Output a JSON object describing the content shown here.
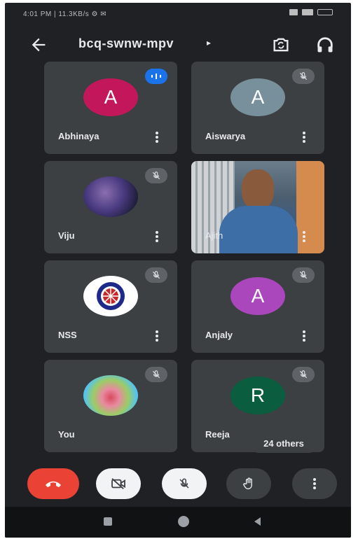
{
  "status_bar": {
    "left_text": "4:01 PM | 11.3KB/s ⚙ ✉",
    "right_text": ""
  },
  "header": {
    "meeting_code": "bcq-swnw-mpv",
    "caret": "▸",
    "icons": [
      "back-arrow-icon",
      "switch-camera-icon",
      "headphones-icon"
    ]
  },
  "participants": [
    {
      "name": "Abhinaya",
      "avatar_letter": "A",
      "avatar_color": "#c2185b",
      "status": "speaking"
    },
    {
      "name": "Aiswarya",
      "avatar_letter": "A",
      "avatar_color": "#78909c",
      "status": "muted"
    },
    {
      "name": "Viju",
      "avatar_letter": "",
      "avatar_type": "photo",
      "status": "muted"
    },
    {
      "name": "Ajith",
      "avatar_letter": "",
      "avatar_type": "video",
      "status": "video"
    },
    {
      "name": "NSS",
      "avatar_letter": "",
      "avatar_type": "logo",
      "status": "muted"
    },
    {
      "name": "Anjaly",
      "avatar_letter": "A",
      "avatar_color": "#ab47bc",
      "status": "muted"
    },
    {
      "name": "You",
      "avatar_letter": "",
      "avatar_type": "photo",
      "status": "muted"
    },
    {
      "name": "Reeja",
      "avatar_letter": "R",
      "avatar_color": "#0b5d3f",
      "status": "muted"
    }
  ],
  "others_label": "24 others",
  "controls": {
    "end_call_color": "#ea4335",
    "buttons": [
      "end-call-icon",
      "camera-off-icon",
      "mic-off-icon",
      "raise-hand-icon",
      "more-options-icon"
    ]
  },
  "nav": [
    "recents-icon",
    "home-icon",
    "back-icon"
  ]
}
